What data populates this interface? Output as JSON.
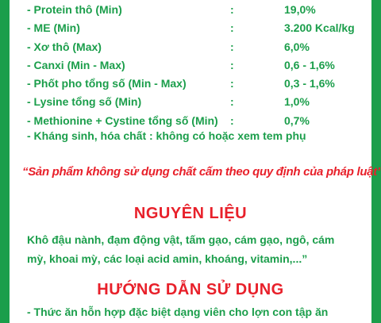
{
  "specs": [
    {
      "name": "- Protein thô (Min)",
      "value": "19,0%"
    },
    {
      "name": "- ME (Min)",
      "value": "3.200 Kcal/kg"
    },
    {
      "name": "- Xơ thô (Max)",
      "value": "6,0%"
    },
    {
      "name": "- Canxi (Min - Max)",
      "value": "0,6 - 1,6%"
    },
    {
      "name": "- Phốt pho tổng số (Min - Max)",
      "value": "0,3 - 1,6%"
    },
    {
      "name": "- Lysine tổng số (Min)",
      "value": "1,0%"
    },
    {
      "name": "- Methionine + Cystine tổng số (Min)",
      "value": "0,7%"
    }
  ],
  "separator": ":",
  "notice": "- Kháng sinh, hóa chất : không có hoặc xem tem phụ",
  "slogan": "“Sản phẩm không sử dụng chất cấm theo quy định của pháp luật”",
  "ingredients_heading": "NGUYÊN LIỆU",
  "ingredients_text_1": "Khô đậu nành, đạm động vật, tấm gạo, cám gạo, ngô, cám",
  "ingredients_text_2": "mỳ, khoai mỳ, các loại acid amin, khoáng, vitamin,...”",
  "usage_heading": "HƯỚNG DẪN SỬ DỤNG",
  "usage_text": "- Thức ăn hỗn hợp đặc biệt dạng viên cho lợn con tập ăn",
  "colors": {
    "green": "#1b9e4b",
    "red": "#e8202a"
  }
}
